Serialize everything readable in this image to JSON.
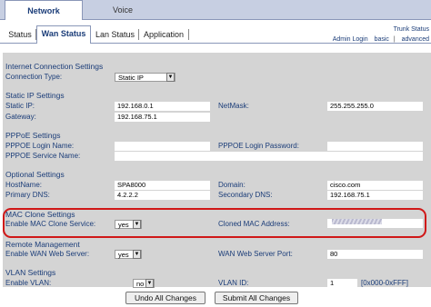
{
  "top_tabs": [
    "Network",
    "Voice"
  ],
  "sub_tabs": [
    "Status",
    "Wan Status",
    "Lan Status",
    "Application"
  ],
  "links": {
    "trunk": "Trunk Status",
    "admin": "Admin Login",
    "basic": "basic",
    "advanced": "advanced"
  },
  "sections": {
    "internet": "Internet Connection Settings",
    "static_ip": "Static IP Settings",
    "pppoe": "PPPoE Settings",
    "optional": "Optional Settings",
    "mac_clone": "MAC Clone Settings",
    "remote": "Remote Management",
    "vlan": "VLAN Settings"
  },
  "fields": {
    "connection_type": {
      "label": "Connection Type:",
      "value": "Static IP"
    },
    "static_ip": {
      "label": "Static IP:",
      "value": "192.168.0.1"
    },
    "netmask": {
      "label": "NetMask:",
      "value": "255.255.255.0"
    },
    "gateway": {
      "label": "Gateway:",
      "value": "192.168.75.1"
    },
    "pppoe_login": {
      "label": "PPPOE Login Name:",
      "value": ""
    },
    "pppoe_password": {
      "label": "PPPOE Login Password:",
      "value": ""
    },
    "pppoe_service": {
      "label": "PPPOE Service Name:",
      "value": ""
    },
    "hostname": {
      "label": "HostName:",
      "value": "SPA8000"
    },
    "domain": {
      "label": "Domain:",
      "value": "cisco.com"
    },
    "primary_dns": {
      "label": "Primary DNS:",
      "value": "4.2.2.2"
    },
    "secondary_dns": {
      "label": "Secondary DNS:",
      "value": "192.168.75.1"
    },
    "mac_clone_service": {
      "label": "Enable MAC Clone Service:",
      "value": "yes"
    },
    "cloned_mac": {
      "label": "Cloned MAC Address:",
      "value": ""
    },
    "wan_web_server": {
      "label": "Enable WAN Web Server:",
      "value": "yes"
    },
    "wan_web_port": {
      "label": "WAN Web Server Port:",
      "value": "80"
    },
    "enable_vlan": {
      "label": "Enable VLAN:",
      "value": "no"
    },
    "vlan_id": {
      "label": "VLAN ID:",
      "value": "1",
      "hint": "[0x000-0xFFF]"
    }
  },
  "buttons": {
    "undo": "Undo All Changes",
    "submit": "Submit All Changes"
  }
}
